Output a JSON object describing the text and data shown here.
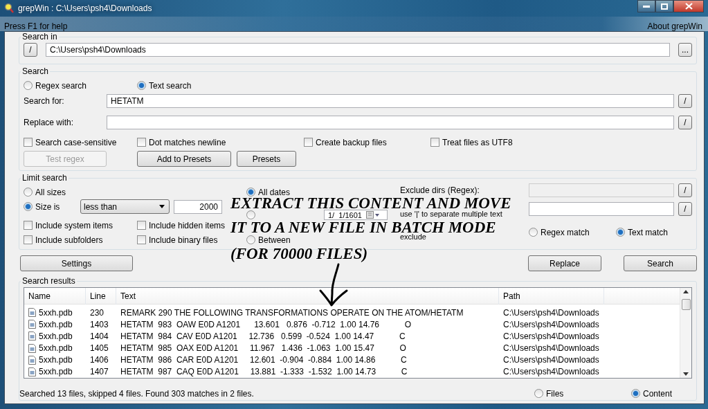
{
  "window": {
    "title": "grepWin : C:\\Users\\psh4\\Downloads"
  },
  "menu": {
    "help": "Press F1 for help",
    "about": "About grepWin"
  },
  "search_in": {
    "legend": "Search in",
    "browse_left": "/",
    "path": "C:\\Users\\psh4\\Downloads",
    "browse": "..."
  },
  "search": {
    "legend": "Search",
    "modes": [
      {
        "label": "Regex search",
        "selected": false
      },
      {
        "label": "Text search",
        "selected": true
      }
    ],
    "search_for": {
      "label": "Search for:",
      "value": "HETATM",
      "button": "/"
    },
    "replace_with": {
      "label": "Replace with:",
      "button": "/"
    },
    "options": [
      {
        "label": "Search case-sensitive",
        "checked": false
      },
      {
        "label": "Dot matches newline",
        "checked": false
      },
      {
        "label": "Create backup files",
        "checked": false
      },
      {
        "label": "Treat files as UTF8",
        "checked": false
      }
    ],
    "buttons": [
      {
        "label": "Test regex",
        "disabled": true
      },
      {
        "label": "Add to Presets",
        "disabled": false
      },
      {
        "label": "Presets",
        "disabled": false
      }
    ]
  },
  "limit": {
    "legend": "Limit search",
    "sizes": [
      {
        "label": "All sizes",
        "selected": false
      },
      {
        "label": "Size is",
        "selected": true
      }
    ],
    "size_op": "less than",
    "size_value": "2000",
    "includes": [
      {
        "label": "Include system items",
        "checked": false
      },
      {
        "label": "Include hidden items",
        "checked": false
      },
      {
        "label": "Include subfolders",
        "checked": false
      },
      {
        "label": "Include binary files",
        "checked": false
      }
    ],
    "dates": [
      {
        "label": "All dates",
        "selected": true
      },
      {
        "selected": false
      },
      {
        "label": "Between",
        "selected": false
      }
    ],
    "date_value": "1/  1/1601",
    "exclude_dirs": {
      "label": "Exclude dirs (Regex):",
      "button": "/"
    },
    "file_names": {
      "hint_lines": [
        "use '|' to separate multiple text",
        "exclude"
      ],
      "button": "/"
    },
    "match": [
      {
        "label": "Regex match",
        "selected": false
      },
      {
        "label": "Text match",
        "selected": true
      }
    ]
  },
  "actions": [
    {
      "label": "Settings"
    },
    {
      "label": "Replace"
    },
    {
      "label": "Search"
    }
  ],
  "results": {
    "legend": "Search results",
    "columns": [
      "Name",
      "Line",
      "Text",
      "Path"
    ],
    "rows": [
      {
        "name": "5xxh.pdb",
        "line": "230",
        "text": "REMARK 290 THE FOLLOWING TRANSFORMATIONS OPERATE ON THE ATOM/HETATM",
        "path": "C:\\Users\\psh4\\Downloads"
      },
      {
        "name": "5xxh.pdb",
        "line": "1403",
        "text": "HETATM  983  OAW E0D A1201      13.601   0.876  -0.712  1.00 14.76           O",
        "path": "C:\\Users\\psh4\\Downloads"
      },
      {
        "name": "5xxh.pdb",
        "line": "1404",
        "text": "HETATM  984  CAV E0D A1201     12.736   0.599  -0.524  1.00 14.47           C",
        "path": "C:\\Users\\psh4\\Downloads"
      },
      {
        "name": "5xxh.pdb",
        "line": "1405",
        "text": "HETATM  985  OAX E0D A1201     11.967   1.436  -1.063  1.00 15.47           O",
        "path": "C:\\Users\\psh4\\Downloads"
      },
      {
        "name": "5xxh.pdb",
        "line": "1406",
        "text": "HETATM  986  CAR E0D A1201     12.601  -0.904  -0.884  1.00 14.86           C",
        "path": "C:\\Users\\psh4\\Downloads"
      },
      {
        "name": "5xxh.pdb",
        "line": "1407",
        "text": "HETATM  987  CAQ E0D A1201     13.881  -1.333  -1.532  1.00 14.73           C",
        "path": "C:\\Users\\psh4\\Downloads"
      }
    ],
    "status": "Searched 13 files, skipped 4 files. Found 303 matches in 2 files.",
    "views": [
      {
        "label": "Files",
        "selected": false
      },
      {
        "label": "Content",
        "selected": true
      }
    ]
  },
  "annotation": {
    "lines": [
      "EXTRACT THIS CONTENT AND MOVE",
      "IT TO A NEW FILE IN BATCH MODE",
      "(FOR 70000 FILES)"
    ]
  }
}
